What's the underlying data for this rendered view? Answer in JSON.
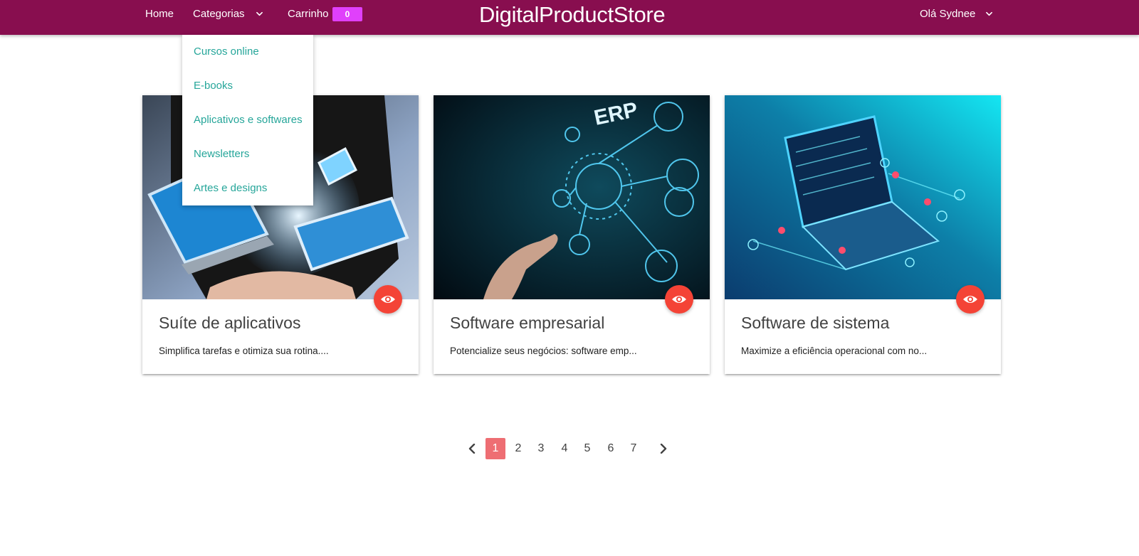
{
  "navbar": {
    "home_label": "Home",
    "categories_label": "Categorias",
    "cart_label": "Carrinho",
    "cart_count": "0",
    "brand": "DigitalProductStore",
    "user_greeting": "Olá Sydnee"
  },
  "dropdown": {
    "items": [
      {
        "label": "Cursos online"
      },
      {
        "label": "E-books"
      },
      {
        "label": "Aplicativos e softwares"
      },
      {
        "label": "Newsletters"
      },
      {
        "label": "Artes e designs"
      }
    ]
  },
  "products": [
    {
      "title": "Suíte de aplicativos",
      "description": "Simplifica tarefas e otimiza sua rotina....",
      "icon": "eye-icon"
    },
    {
      "title": "Software empresarial",
      "description": "Potencialize seus negócios: software emp...",
      "icon": "eye-icon"
    },
    {
      "title": "Software de sistema",
      "description": "Maximize a eficiência operacional com no...",
      "icon": "eye-icon"
    }
  ],
  "pagination": {
    "pages": [
      "1",
      "2",
      "3",
      "4",
      "5",
      "6",
      "7"
    ],
    "current": "1"
  },
  "colors": {
    "navbar": "#880e4f",
    "cart_badge": "#e040fb",
    "dropdown_link": "#26a69a",
    "fab": "#f44336",
    "active_page": "#ee6e73"
  }
}
